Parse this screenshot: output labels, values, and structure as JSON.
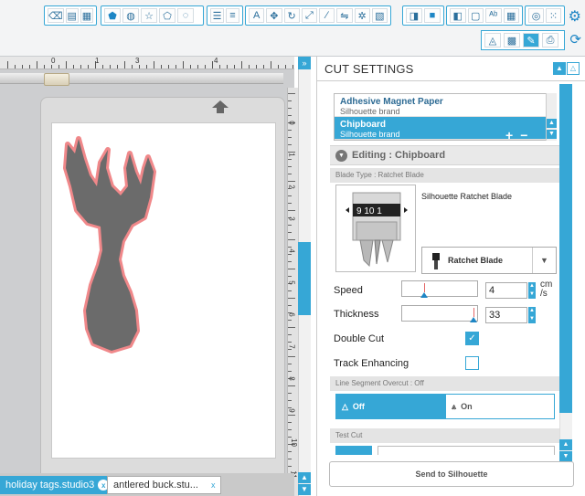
{
  "toolbar": {
    "text_tool": "A",
    "row2_icons": [
      "mat-view-icon",
      "grid-view-icon",
      "cut-settings-icon",
      "send-panel-icon"
    ],
    "right_icons": [
      "gear-icon",
      "sync-icon"
    ]
  },
  "ruler": {
    "top_numbers": [
      "0",
      "1",
      "3",
      "4"
    ],
    "side_numbers": [
      "0",
      "1",
      "2",
      "3",
      "4",
      "5",
      "6",
      "7",
      "8",
      "9",
      "10",
      "11",
      "12"
    ]
  },
  "doc_tabs": [
    {
      "label": "holiday tags.studio3",
      "active": true
    },
    {
      "label": "antlered buck.stu...",
      "active": false
    }
  ],
  "panel": {
    "title": "CUT SETTINGS",
    "materials": [
      {
        "name": "Adhesive Magnet Paper",
        "brand": "Silhouette brand",
        "selected": false
      },
      {
        "name": "Chipboard",
        "brand": "Silhouette brand",
        "selected": true
      }
    ],
    "plus": "+",
    "minus": "−",
    "editing_label": "Editing : Chipboard",
    "blade_type_header": "Blade Type : Ratchet Blade",
    "blade_image_numbers": "9 10 1",
    "blade_name": "Silhouette Ratchet Blade",
    "blade_select": "Ratchet Blade",
    "speed_label": "Speed",
    "speed_value": "4",
    "speed_unit": "cm\n/s",
    "speed_fraction": 0.3,
    "thickness_label": "Thickness",
    "thickness_value": "33",
    "thickness_fraction": 0.97,
    "double_cut_label": "Double Cut",
    "double_cut_checked": true,
    "track_enhancing_label": "Track Enhancing",
    "track_enhancing_checked": false,
    "overcut_header": "Line Segment Overcut : Off",
    "overcut_off": "Off",
    "overcut_on": "On",
    "test_cut_header": "Test Cut",
    "send_button": "Send to Silhouette"
  },
  "colors": {
    "accent": "#36a7d6",
    "deer_fill": "#6b6b6b",
    "deer_outline": "#f0888a"
  }
}
